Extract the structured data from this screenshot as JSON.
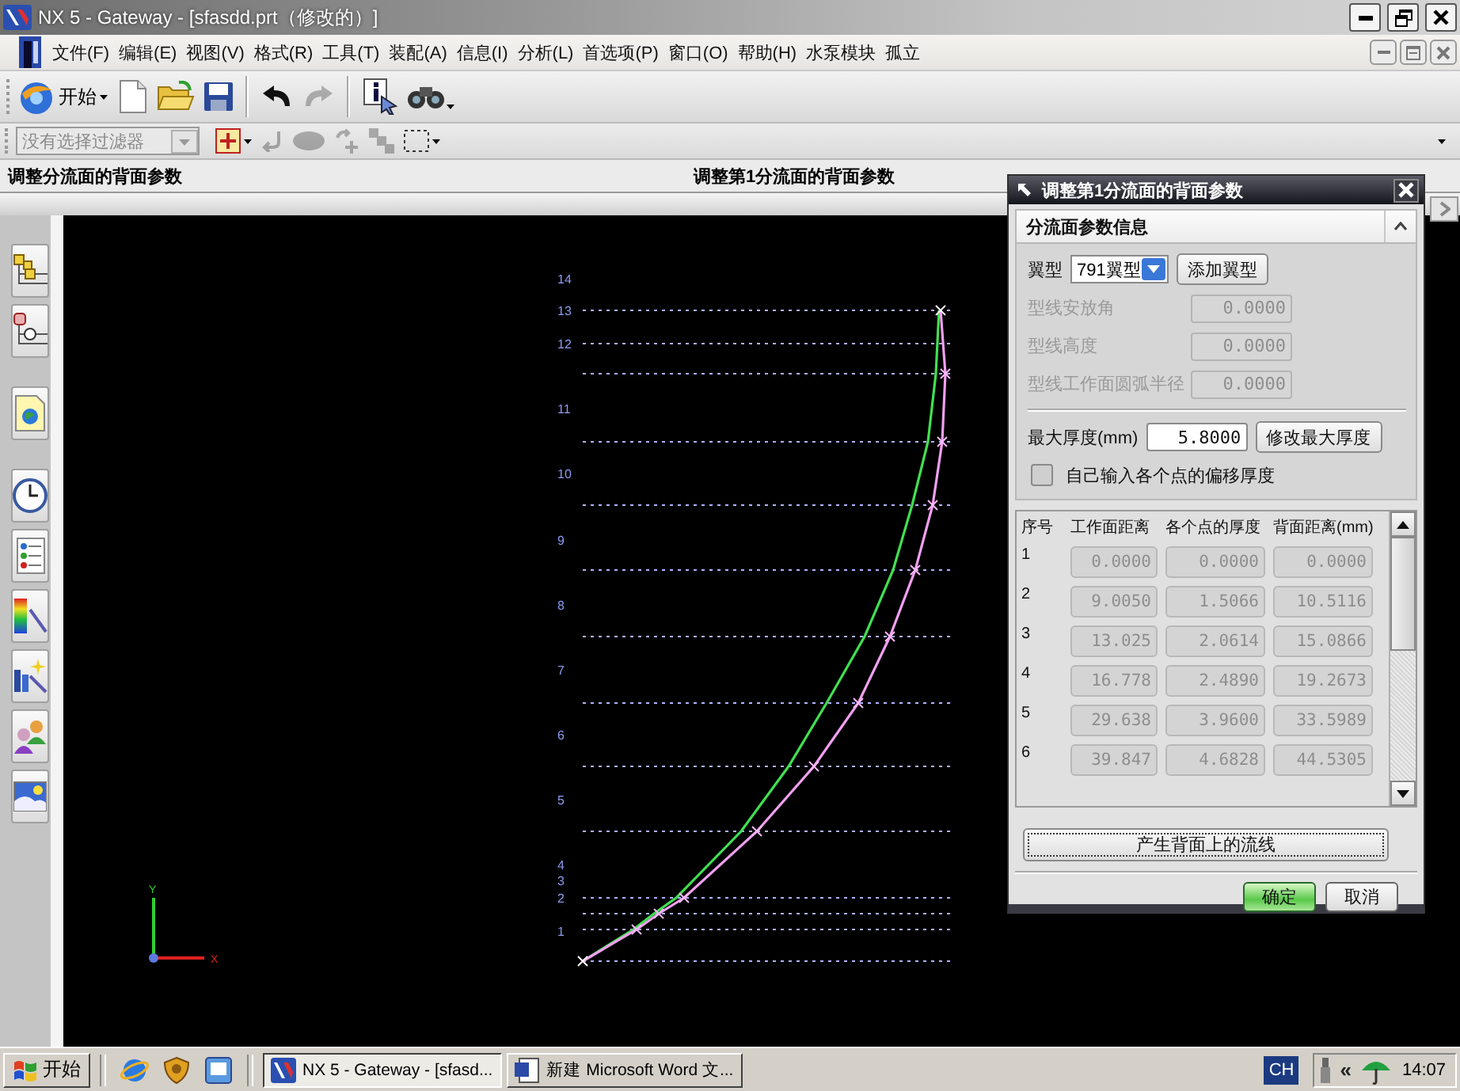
{
  "window": {
    "title": "NX 5 - Gateway - [sfasdd.prt（修改的）]"
  },
  "menu_bar": {
    "items": [
      "文件(F)",
      "编辑(E)",
      "视图(V)",
      "格式(R)",
      "工具(T)",
      "装配(A)",
      "信息(I)",
      "分析(L)",
      "首选项(P)",
      "窗口(O)",
      "帮助(H)",
      "水泵模块",
      "孤立"
    ]
  },
  "toolbar": {
    "start_button": "开始",
    "buttons": [
      {
        "kind": "new",
        "disabled": false
      },
      {
        "kind": "open",
        "disabled": false
      },
      {
        "kind": "save",
        "disabled": false
      },
      {
        "kind": "undo",
        "disabled": false
      },
      {
        "kind": "redo",
        "disabled": true
      },
      {
        "kind": "info",
        "disabled": false
      },
      {
        "kind": "view",
        "disabled": false
      }
    ]
  },
  "filter_bar": {
    "filter": {
      "value": "没有选择过滤器",
      "disabled": true
    },
    "tools": [
      {
        "kind": "snap",
        "disabled": false
      },
      {
        "kind": "hook",
        "disabled": true
      },
      {
        "kind": "body",
        "disabled": true
      },
      {
        "kind": "turn",
        "disabled": true
      },
      {
        "kind": "chain",
        "disabled": true
      },
      {
        "kind": "marquee",
        "disabled": false
      }
    ]
  },
  "cue_line": {
    "prompt": "调整分流面的背面参数",
    "status": "调整第1分流面的背面参数"
  },
  "canvas": {
    "point_labels": [
      "14",
      "13",
      "12",
      "11",
      "10",
      "9",
      "8",
      "7",
      "6",
      "5",
      "4",
      "3",
      "2",
      "1"
    ],
    "axis_labels": [
      "Y",
      "X"
    ]
  },
  "dialog": {
    "title": "调整第1分流面的背面参数",
    "group": {
      "title": "分流面参数信息",
      "expanded": true,
      "airfoil": {
        "label": "翼型",
        "value": "791翼型",
        "button": "添加翼型"
      },
      "fields": [
        {
          "label": "型线安放角",
          "value": "0.0000",
          "disabled": true
        },
        {
          "label": "型线高度",
          "value": "0.0000",
          "disabled": true
        },
        {
          "label": "型线工作面圆弧半径",
          "value": "0.0000",
          "disabled": true
        }
      ],
      "max_thickness": {
        "label": "最大厚度(mm)",
        "value": "5.8000",
        "button": "修改最大厚度"
      },
      "custom_offset": {
        "label": "自己输入各个点的偏移厚度",
        "checked": false
      }
    },
    "table": {
      "columns": [
        "序号",
        "工作面距离",
        "各个点的厚度",
        "背面距离(mm)"
      ],
      "rows": [
        {
          "cells": [
            "1",
            "0.0000",
            "0.0000",
            "0.0000"
          ],
          "disabled": true
        },
        {
          "cells": [
            "2",
            "9.0050",
            "1.5066",
            "10.5116"
          ],
          "disabled": true
        },
        {
          "cells": [
            "3",
            "13.025",
            "2.0614",
            "15.0866"
          ],
          "disabled": true
        },
        {
          "cells": [
            "4",
            "16.778",
            "2.4890",
            "19.2673"
          ],
          "disabled": true
        },
        {
          "cells": [
            "5",
            "29.638",
            "3.9600",
            "33.5989"
          ],
          "disabled": true
        },
        {
          "cells": [
            "6",
            "39.847",
            "4.6828",
            "44.5305"
          ],
          "disabled": true
        }
      ]
    },
    "generate_button": "产生背面上的流线",
    "buttons": [
      {
        "label": "确定",
        "default": true
      },
      {
        "label": "取消",
        "default": false
      }
    ]
  },
  "taskbar": {
    "start_button": "开始",
    "tasks": [
      {
        "label": "NX 5 - Gateway - [sfasd...",
        "selected": true
      },
      {
        "label": "新建 Microsoft Word 文...",
        "selected": false
      }
    ],
    "language": "CH",
    "tray_toggle": "«",
    "clock": "14:07"
  }
}
